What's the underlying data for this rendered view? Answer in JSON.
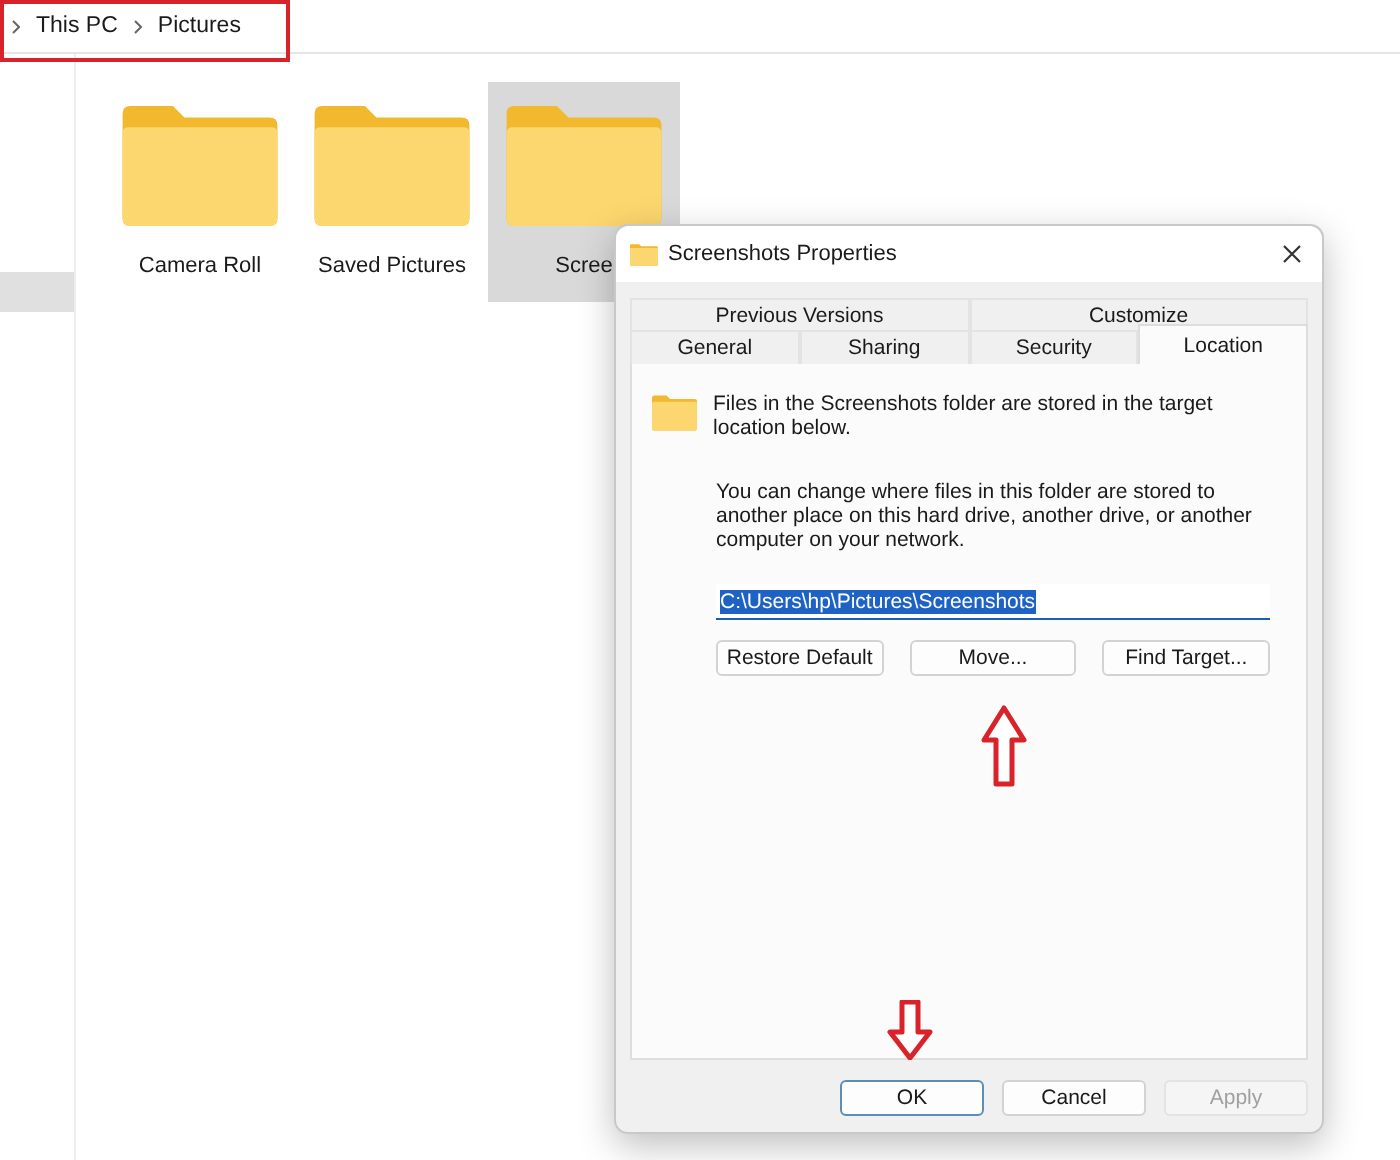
{
  "breadcrumb": [
    {
      "label": "This PC"
    },
    {
      "label": "Pictures"
    }
  ],
  "folders": [
    {
      "name": "Camera Roll",
      "selected": false
    },
    {
      "name": "Saved Pictures",
      "selected": false
    },
    {
      "name": "Scree",
      "selected": true
    }
  ],
  "dialog": {
    "title": "Screenshots Properties",
    "tab_rows": [
      [
        {
          "label": "Previous Versions",
          "selected": false
        },
        {
          "label": "Customize",
          "selected": false
        }
      ],
      [
        {
          "label": "General",
          "selected": false
        },
        {
          "label": "Sharing",
          "selected": false
        },
        {
          "label": "Security",
          "selected": false
        },
        {
          "label": "Location",
          "selected": true
        }
      ]
    ],
    "info": "Files in the Screenshots folder are stored in the target location below.",
    "description": "You can change where files in this folder are stored to another place on this hard drive, another drive, or another computer on your network.",
    "path": {
      "value": "C:\\Users\\hp\\Pictures\\Screenshots",
      "selected": true
    },
    "location_buttons": [
      {
        "label": "Restore Default"
      },
      {
        "label": "Move..."
      },
      {
        "label": "Find Target..."
      }
    ],
    "footer_buttons": [
      {
        "label": "OK",
        "default": true,
        "disabled": false
      },
      {
        "label": "Cancel",
        "default": false,
        "disabled": false
      },
      {
        "label": "Apply",
        "default": false,
        "disabled": true
      }
    ]
  }
}
